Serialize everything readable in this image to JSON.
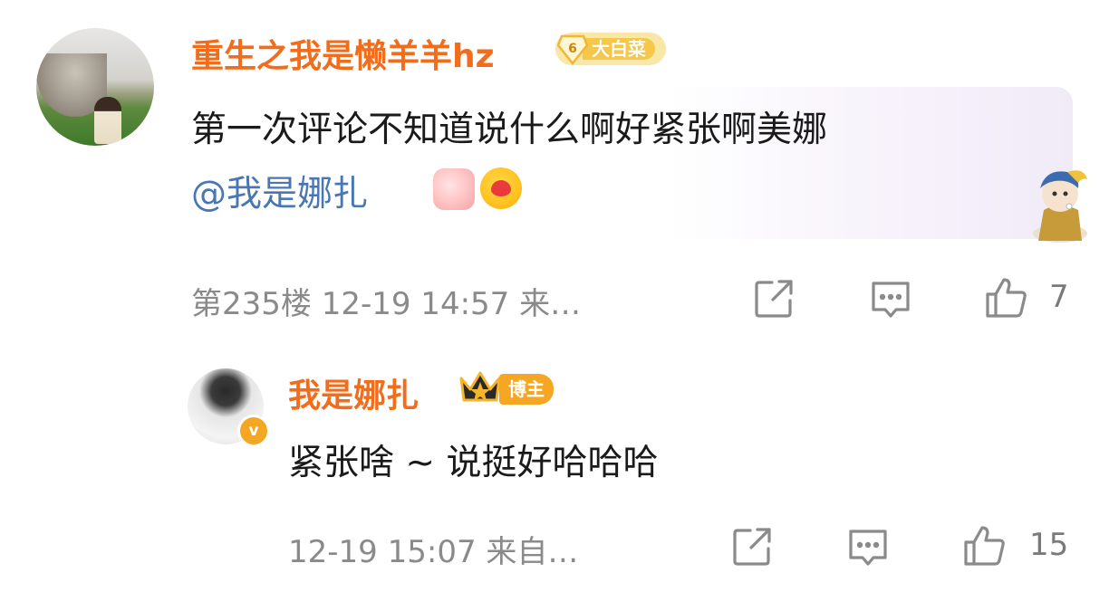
{
  "comments": [
    {
      "username": "重生之我是懒羊羊hz",
      "badge": {
        "level": "6",
        "label": "大白菜"
      },
      "text": "第一次评论不知道说什么啊好紧张啊美娜",
      "mention": "@我是娜扎",
      "emojis": [
        "blushing-sticker-icon",
        "hug-heart-emoji-icon"
      ],
      "meta": "第235楼 12-19 14:57 来…",
      "likes": "7"
    },
    {
      "username": "我是娜扎",
      "badge": {
        "label": "博主",
        "verified": "v"
      },
      "text": "紧张啥 ~ 说挺好哈哈哈",
      "meta": "12-19 15:07 来自…",
      "likes": "15"
    }
  ],
  "colors": {
    "username": "#f26d1b",
    "mention": "#4a77b4",
    "meta": "#8a8a8a",
    "owner_tag": "#f5a623"
  }
}
